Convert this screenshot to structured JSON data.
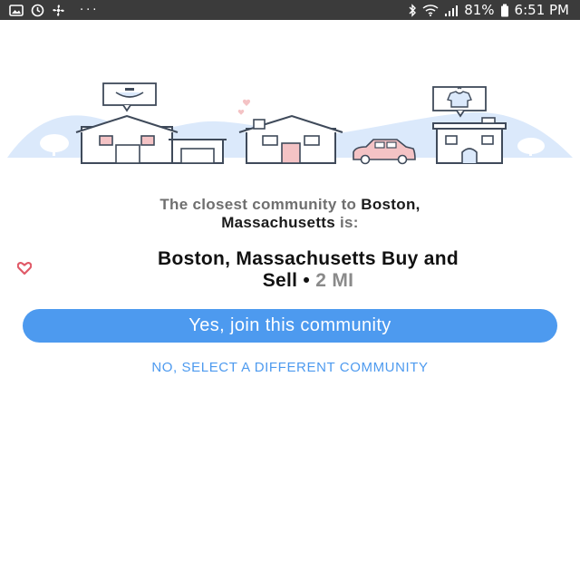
{
  "status_bar": {
    "left_icons": [
      "gallery-icon",
      "sync-icon",
      "fan-icon"
    ],
    "more": "···",
    "battery_percent": "81%",
    "time": "6:51 PM",
    "right_icons": [
      "bluetooth-icon",
      "wifi-icon",
      "signal-icon",
      "battery-icon"
    ]
  },
  "message": {
    "prefix": "The closest community to",
    "city": "Boston,",
    "region": "Massachusetts",
    "suffix": "is:"
  },
  "community": {
    "name_line1": "Boston, Massachusetts Buy and",
    "name_line2": "Sell",
    "separator": "•",
    "distance": "2 MI",
    "icon": "heart-icon"
  },
  "actions": {
    "join_label": "Yes, join this community",
    "different_label": "NO, SELECT A DIFFERENT COMMUNITY"
  },
  "colors": {
    "status_bar": "#3b3b3b",
    "accent": "#4d9aef",
    "heart": "#e05a68",
    "hills": "#dbe9fb",
    "house_accent": "#f4c3c5"
  }
}
